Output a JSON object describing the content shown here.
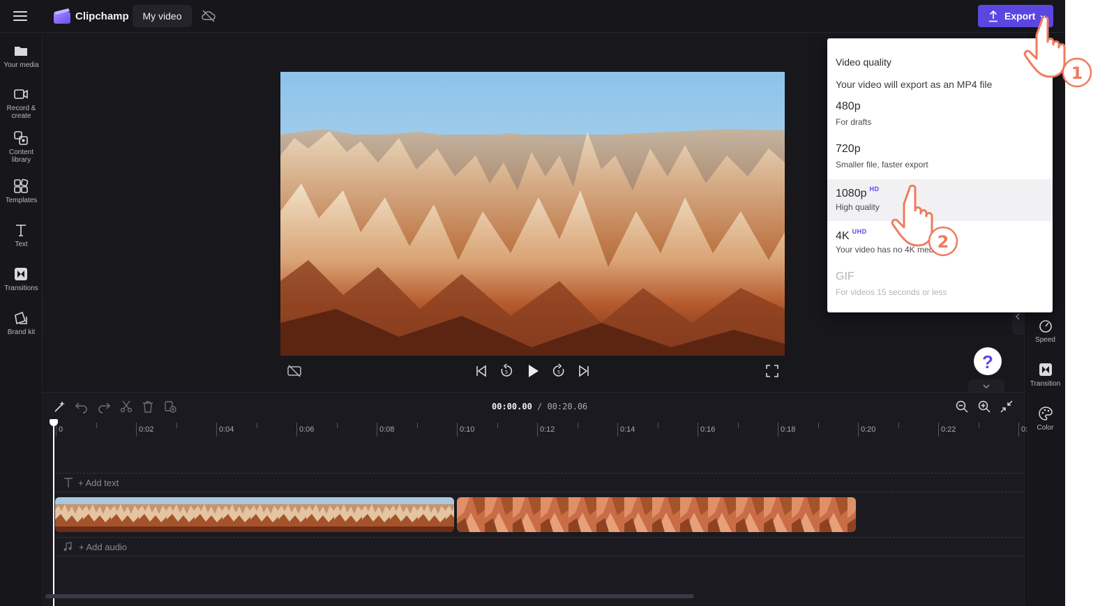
{
  "app": {
    "name": "Clipchamp",
    "project_title": "My video"
  },
  "export_button": {
    "label": "Export"
  },
  "left_sidebar": {
    "items": [
      {
        "label": "Your media"
      },
      {
        "label": "Record &\ncreate"
      },
      {
        "label": "Content\nlibrary"
      },
      {
        "label": "Templates"
      },
      {
        "label": "Text"
      },
      {
        "label": "Transitions"
      },
      {
        "label": "Brand kit"
      }
    ]
  },
  "right_sidebar": {
    "items": [
      {
        "label": "Speed"
      },
      {
        "label": "Transition"
      },
      {
        "label": "Color"
      }
    ]
  },
  "help": {
    "label": "?"
  },
  "timeline": {
    "current_time": "00:00.00",
    "total_time": "/ 00:20.06",
    "ruler_labels": [
      "0",
      "0:02",
      "0:04",
      "0:06",
      "0:08",
      "0:10",
      "0:12",
      "0:14",
      "0:16",
      "0:18",
      "0:20",
      "0:22",
      "0:"
    ],
    "add_text": "+ Add text",
    "add_audio": "+ Add audio"
  },
  "export_dropdown": {
    "heading": "Video quality",
    "subtitle": "Your video will export as an MP4 file",
    "options": [
      {
        "title": "480p",
        "badge": "",
        "desc": "For drafts",
        "enabled": true
      },
      {
        "title": "720p",
        "badge": "",
        "desc": "Smaller file, faster export",
        "enabled": true
      },
      {
        "title": "1080p",
        "badge": "HD",
        "desc": "High quality",
        "enabled": true
      },
      {
        "title": "4K",
        "badge": "UHD",
        "desc": "Your video has no 4K media",
        "enabled": true
      },
      {
        "title": "GIF",
        "badge": "",
        "desc": "For videos 15 seconds or less",
        "enabled": false
      }
    ]
  },
  "annotations": {
    "step1": "1",
    "step2": "2"
  },
  "colors": {
    "accent": "#5b47e0",
    "background": "#17171c",
    "cursor_callout": "#f07a5d"
  }
}
